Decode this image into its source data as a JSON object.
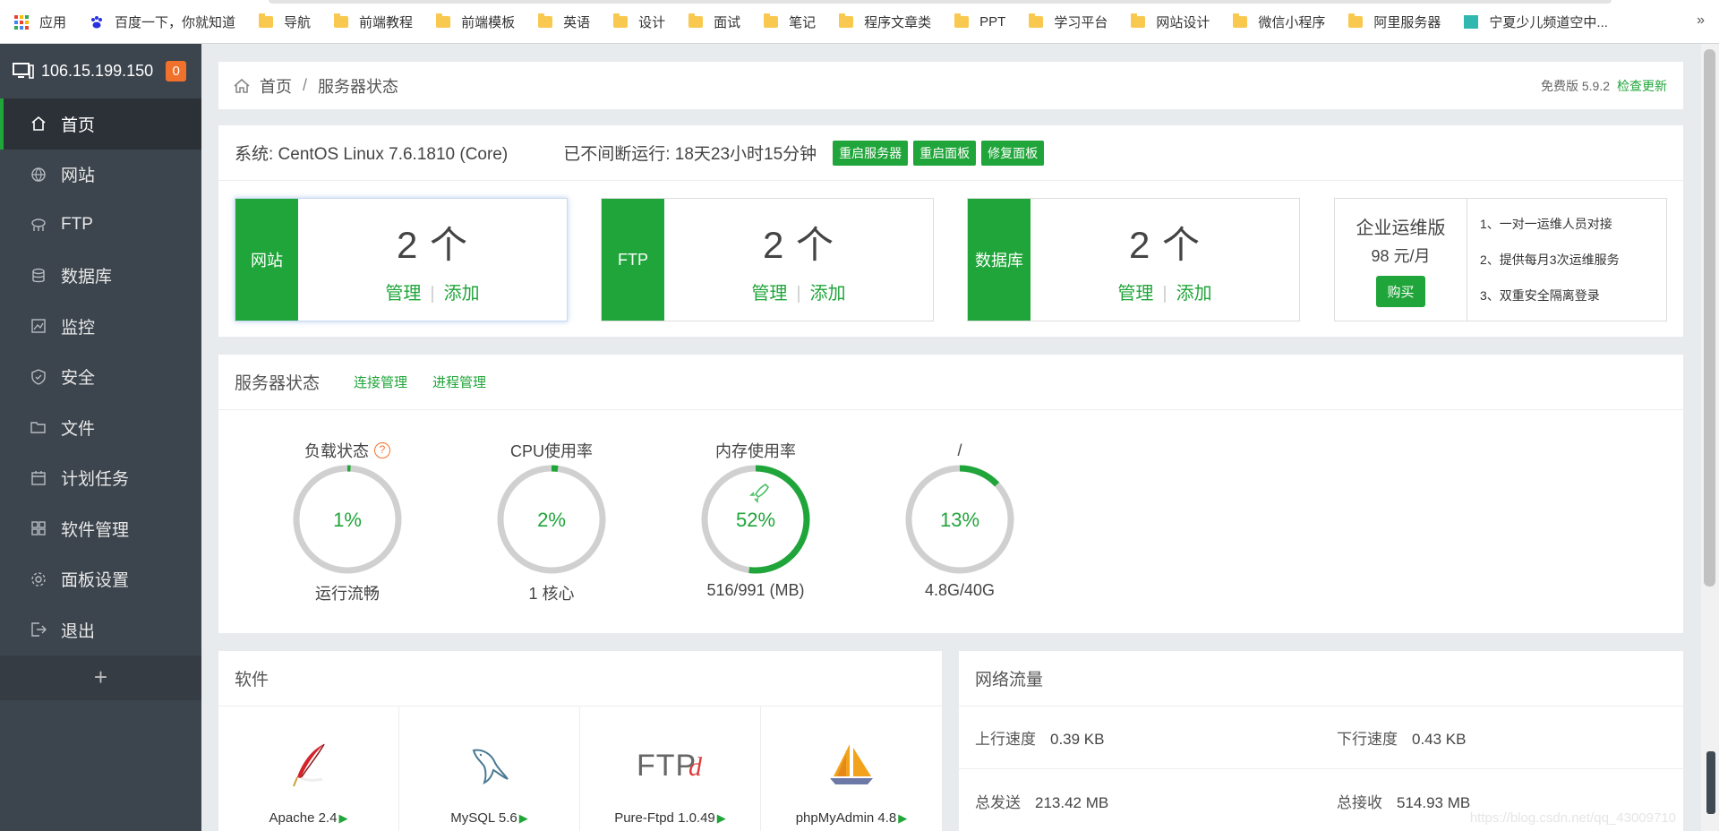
{
  "bookmarks": [
    {
      "label": "应用",
      "icon": "apps-icon"
    },
    {
      "label": "百度一下，你就知道",
      "icon": "baidu-paw-icon"
    },
    {
      "label": "导航",
      "icon": "folder-icon"
    },
    {
      "label": "前端教程",
      "icon": "folder-icon"
    },
    {
      "label": "前端模板",
      "icon": "folder-icon"
    },
    {
      "label": "英语",
      "icon": "folder-icon"
    },
    {
      "label": "设计",
      "icon": "folder-icon"
    },
    {
      "label": "面试",
      "icon": "folder-icon"
    },
    {
      "label": "笔记",
      "icon": "folder-icon"
    },
    {
      "label": "程序文章类",
      "icon": "folder-icon"
    },
    {
      "label": "PPT",
      "icon": "folder-icon"
    },
    {
      "label": "学习平台",
      "icon": "folder-icon"
    },
    {
      "label": "网站设计",
      "icon": "folder-icon"
    },
    {
      "label": "微信小程序",
      "icon": "folder-icon"
    },
    {
      "label": "阿里服务器",
      "icon": "folder-icon"
    },
    {
      "label": "宁夏少儿频道空中...",
      "icon": "site-favicon"
    }
  ],
  "bookmarks_more": "»",
  "sidebar": {
    "server_ip": "106.15.199.150",
    "badge_count": "0",
    "items": [
      {
        "label": "首页",
        "icon": "home-icon",
        "active": true
      },
      {
        "label": "网站",
        "icon": "globe-icon"
      },
      {
        "label": "FTP",
        "icon": "ftp-icon"
      },
      {
        "label": "数据库",
        "icon": "database-icon"
      },
      {
        "label": "监控",
        "icon": "monitor-icon"
      },
      {
        "label": "安全",
        "icon": "shield-icon"
      },
      {
        "label": "文件",
        "icon": "folder-open-icon"
      },
      {
        "label": "计划任务",
        "icon": "calendar-icon"
      },
      {
        "label": "软件管理",
        "icon": "grid-icon"
      },
      {
        "label": "面板设置",
        "icon": "gear-icon"
      },
      {
        "label": "退出",
        "icon": "logout-icon"
      }
    ],
    "add_label": "+"
  },
  "breadcrumb": {
    "home": "首页",
    "separator": "/",
    "current": "服务器状态",
    "version": "免费版 5.9.2",
    "check_update": "检查更新"
  },
  "system": {
    "os": "系统: CentOS Linux 7.6.1810 (Core)",
    "uptime": "已不间断运行: 18天23小时15分钟",
    "buttons": [
      "重启服务器",
      "重启面板",
      "修复面板"
    ]
  },
  "cards": [
    {
      "tag": "网站",
      "count": "2 个",
      "manage": "管理",
      "add": "添加"
    },
    {
      "tag": "FTP",
      "count": "2 个",
      "manage": "管理",
      "add": "添加"
    },
    {
      "tag": "数据库",
      "count": "2 个",
      "manage": "管理",
      "add": "添加"
    }
  ],
  "card_separator": "|",
  "enterprise": {
    "title": "企业运维版",
    "price": "98 元/月",
    "buy": "购买",
    "features": [
      "1、一对一运维人员对接",
      "2、提供每月3次运维服务",
      "3、双重安全隔离登录"
    ]
  },
  "server_status": {
    "title": "服务器状态",
    "links": [
      "连接管理",
      "进程管理"
    ],
    "gauges": [
      {
        "label": "负载状态",
        "help": "?",
        "value_text": "1%",
        "percent": 1,
        "sub": "运行流畅"
      },
      {
        "label": "CPU使用率",
        "value_text": "2%",
        "percent": 2,
        "sub": "1 核心"
      },
      {
        "label": "内存使用率",
        "value_text": "52%",
        "percent": 52,
        "sub": "516/991 (MB)",
        "rocket": true
      },
      {
        "label": "/",
        "value_text": "13%",
        "percent": 13,
        "sub": "4.8G/40G"
      }
    ]
  },
  "software": {
    "title": "软件",
    "items": [
      {
        "name": "Apache 2.4",
        "icon": "apache-feather-icon"
      },
      {
        "name": "MySQL 5.6",
        "icon": "mysql-dolphin-icon"
      },
      {
        "name": "Pure-Ftpd 1.0.49",
        "icon": "ftpd-logo-icon"
      },
      {
        "name": "phpMyAdmin 4.8",
        "icon": "phpmyadmin-sailboat-icon"
      }
    ]
  },
  "network": {
    "title": "网络流量",
    "rows": [
      [
        {
          "k": "上行速度",
          "v": "0.39 KB"
        },
        {
          "k": "下行速度",
          "v": "0.43 KB"
        }
      ],
      [
        {
          "k": "总发送",
          "v": "213.42 MB"
        },
        {
          "k": "总接收",
          "v": "514.93 MB"
        }
      ]
    ]
  },
  "watermark": "https://blog.csdn.net/qq_43009710",
  "colors": {
    "accent": "#20a53a",
    "sidebar": "#3c444d",
    "badge": "#f0712c",
    "gauge_track": "#d0d0d0"
  }
}
